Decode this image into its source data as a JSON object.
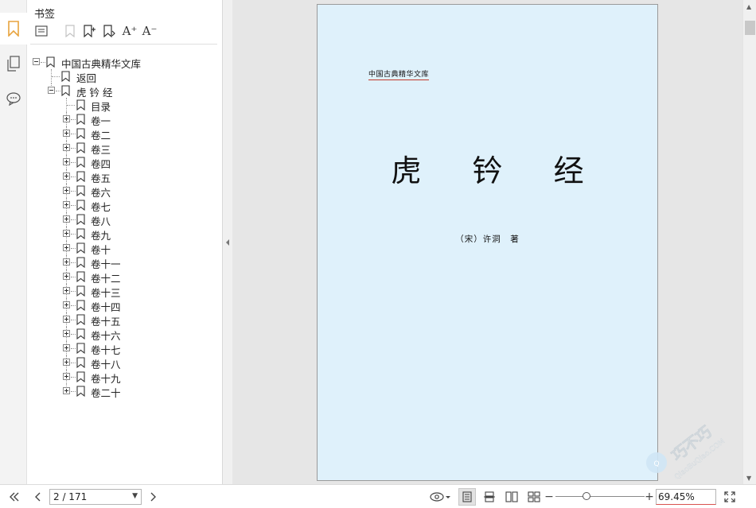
{
  "sidebar": {
    "title": "书签",
    "tools": [
      "expand-all-icon",
      "bookmark-disabled-icon",
      "add-bookmark-icon",
      "add-child-bookmark-icon",
      "font-larger-icon",
      "font-smaller-icon"
    ],
    "font_larger": "A⁺",
    "font_smaller": "A⁻"
  },
  "bookmarks": {
    "root": "中国古典精华文库",
    "back": "返回",
    "book": "虎 钤 经",
    "toc": "目录",
    "chapters": [
      "卷一",
      "卷二",
      "卷三",
      "卷四",
      "卷五",
      "卷六",
      "卷七",
      "卷八",
      "卷九",
      "卷十",
      "卷十一",
      "卷十二",
      "卷十三",
      "卷十四",
      "卷十五",
      "卷十六",
      "卷十七",
      "卷十八",
      "卷十九",
      "卷二十"
    ]
  },
  "page": {
    "series": "中国古典精华文库",
    "title": "虎 钤 经",
    "author": "（宋）许洞　著"
  },
  "watermark": {
    "brand": "巧不巧",
    "url": "QiaoBuQiao.COM"
  },
  "status": {
    "page_indicator": "2 / 171",
    "zoom": "69.45%"
  },
  "colors": {
    "page_bg": "#dff1fb",
    "accent_bookmark": "#e8a33d",
    "series_underline": "#c0392b"
  }
}
